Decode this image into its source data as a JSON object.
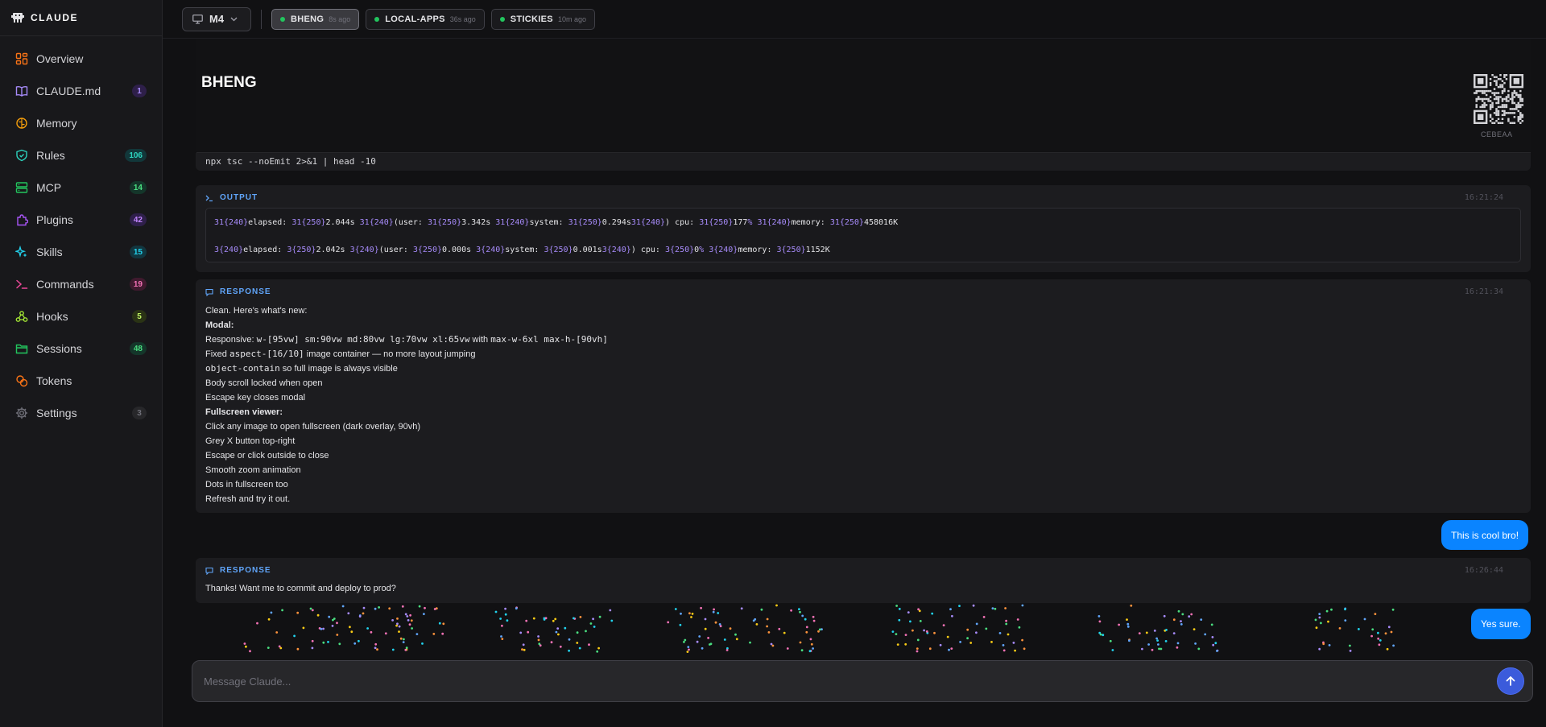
{
  "brand": {
    "name": "CLAUDE"
  },
  "sidebar": {
    "items": [
      {
        "label": "Overview",
        "icon": "grid-icon",
        "color": "#f97316",
        "badge": ""
      },
      {
        "label": "CLAUDE.md",
        "icon": "book-icon",
        "color": "#a78bfa",
        "badge": "1",
        "badge_bg": "#2e1f4a",
        "badge_fg": "#a78bfa"
      },
      {
        "label": "Memory",
        "icon": "brain-icon",
        "color": "#f59e0b",
        "badge": ""
      },
      {
        "label": "Rules",
        "icon": "shield-check-icon",
        "color": "#2dd4bf",
        "badge": "106",
        "badge_bg": "#12373a",
        "badge_fg": "#2dd4bf"
      },
      {
        "label": "MCP",
        "icon": "server-icon",
        "color": "#22c55e",
        "badge": "14",
        "badge_bg": "#14362a",
        "badge_fg": "#4ade80"
      },
      {
        "label": "Plugins",
        "icon": "puzzle-icon",
        "color": "#a855f7",
        "badge": "42",
        "badge_bg": "#2e1f4a",
        "badge_fg": "#c084fc"
      },
      {
        "label": "Skills",
        "icon": "sparkle-icon",
        "color": "#22d3ee",
        "badge": "15",
        "badge_bg": "#12363f",
        "badge_fg": "#22d3ee"
      },
      {
        "label": "Commands",
        "icon": "terminal-icon",
        "color": "#ec4899",
        "badge": "19",
        "badge_bg": "#3f1a2e",
        "badge_fg": "#f472b6"
      },
      {
        "label": "Hooks",
        "icon": "webhook-icon",
        "color": "#a3e635",
        "badge": "5",
        "badge_bg": "#2a3315",
        "badge_fg": "#bef264"
      },
      {
        "label": "Sessions",
        "icon": "folder-icon",
        "color": "#22c55e",
        "badge": "48",
        "badge_bg": "#14362a",
        "badge_fg": "#4ade80"
      },
      {
        "label": "Tokens",
        "icon": "coins-icon",
        "color": "#f97316",
        "badge": ""
      },
      {
        "label": "Settings",
        "icon": "gear-icon",
        "color": "#71717a",
        "badge": "3",
        "badge_bg": "#27272a",
        "badge_fg": "#71717a"
      }
    ]
  },
  "topbar": {
    "machine": "M4",
    "tabs": [
      {
        "label": "BHENG",
        "time": "8s ago"
      },
      {
        "label": "LOCAL-APPS",
        "time": "36s ago"
      },
      {
        "label": "STICKIES",
        "time": "10m ago"
      }
    ]
  },
  "header": {
    "title": "BHENG",
    "qr_code_label": "CEBEAA"
  },
  "conversation": {
    "command": "npx tsc --noEmit 2>&1 | head -10",
    "output": {
      "label": "OUTPUT",
      "time": "16:21:24",
      "line1": [
        {
          "t": "31{240}",
          "n": true
        },
        {
          "t": "elapsed: "
        },
        {
          "t": "31{250}",
          "n": true
        },
        {
          "t": "2.044s "
        },
        {
          "t": "31{240}",
          "n": true
        },
        {
          "t": "(user: "
        },
        {
          "t": "31{250}",
          "n": true
        },
        {
          "t": "3.342s "
        },
        {
          "t": "31{240}",
          "n": true
        },
        {
          "t": "system: "
        },
        {
          "t": "31{250}",
          "n": true
        },
        {
          "t": "0.294s"
        },
        {
          "t": "31{240}",
          "n": true
        },
        {
          "t": ") cpu: "
        },
        {
          "t": "31{250}",
          "n": true
        },
        {
          "t": "177"
        },
        {
          "t": "%",
          "n": true
        },
        {
          "t": " "
        },
        {
          "t": "31{240}",
          "n": true
        },
        {
          "t": "memory: "
        },
        {
          "t": "31{250}",
          "n": true
        },
        {
          "t": "458016K"
        }
      ],
      "line2": [
        {
          "t": "3{240}",
          "n": true
        },
        {
          "t": "elapsed: "
        },
        {
          "t": "3{250}",
          "n": true
        },
        {
          "t": "2.042s "
        },
        {
          "t": "3{240}",
          "n": true
        },
        {
          "t": "(user: "
        },
        {
          "t": "3{250}",
          "n": true
        },
        {
          "t": "0.000s "
        },
        {
          "t": "3{240}",
          "n": true
        },
        {
          "t": "system: "
        },
        {
          "t": "3{250}",
          "n": true
        },
        {
          "t": "0.001s"
        },
        {
          "t": "3{240}",
          "n": true
        },
        {
          "t": ") cpu: "
        },
        {
          "t": "3{250}",
          "n": true
        },
        {
          "t": "0"
        },
        {
          "t": "%",
          "n": true
        },
        {
          "t": " "
        },
        {
          "t": "3{240}",
          "n": true
        },
        {
          "t": "memory: "
        },
        {
          "t": "3{250}",
          "n": true
        },
        {
          "t": "1152K"
        }
      ]
    },
    "response1": {
      "label": "RESPONSE",
      "time": "16:21:34",
      "lines": [
        {
          "text": "Clean. Here's what's new:"
        },
        {
          "text": "Modal:",
          "bold": true
        },
        {
          "text": "Responsive: ",
          "code": "w-[95vw] sm:90vw md:80vw lg:70vw xl:65vw",
          "after": " with ",
          "code2": "max-w-6xl max-h-[90vh]"
        },
        {
          "text": "Fixed ",
          "code": "aspect-[16/10]",
          "after": " image container — no more layout jumping"
        },
        {
          "code": "object-contain",
          "after": " so full image is always visible"
        },
        {
          "text": "Body scroll locked when open"
        },
        {
          "text": "Escape key closes modal"
        },
        {
          "text": "Fullscreen viewer:",
          "bold": true
        },
        {
          "text": "Click any image to open fullscreen (dark overlay, 90vh)"
        },
        {
          "text": "Grey X button top-right"
        },
        {
          "text": "Escape or click outside to close"
        },
        {
          "text": "Smooth zoom animation"
        },
        {
          "text": "Dots in fullscreen too"
        },
        {
          "text": "Refresh and try it out."
        }
      ]
    },
    "user1": "This is cool bro!",
    "response2": {
      "label": "RESPONSE",
      "time": "16:26:44",
      "text": "Thanks! Want me to commit and deploy to prod?"
    },
    "user2": "Yes sure."
  },
  "composer": {
    "placeholder": "Message Claude..."
  },
  "colors": {
    "accent": "#0a84ff",
    "send": "#3b5bdb",
    "section_label": "#60a5fa"
  }
}
